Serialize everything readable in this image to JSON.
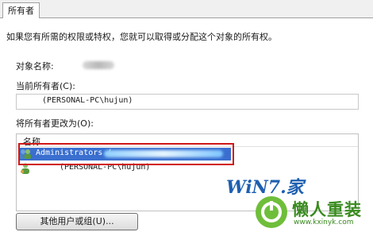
{
  "tab": {
    "label": "所有者"
  },
  "intro": "如果您有所需的权限或特权，您就可以取得或分配这个对象的所有权。",
  "object_name": {
    "label": "对象名称:"
  },
  "current_owner": {
    "label": "当前所有者(C):",
    "value": "(PERSONAL-PC\\hujun)"
  },
  "change_to": {
    "label": "将所有者更改为(O):"
  },
  "list": {
    "header": "名称",
    "items": [
      {
        "name": "Administrators ("
      },
      {
        "name": "(PERSONAL-PC\\hujun)"
      }
    ]
  },
  "button": {
    "label": "其他用户或组(U)..."
  },
  "watermark": {
    "brand": "WiN7.家",
    "slogan": "懒人重装",
    "url": "www.kxinyk.com"
  }
}
